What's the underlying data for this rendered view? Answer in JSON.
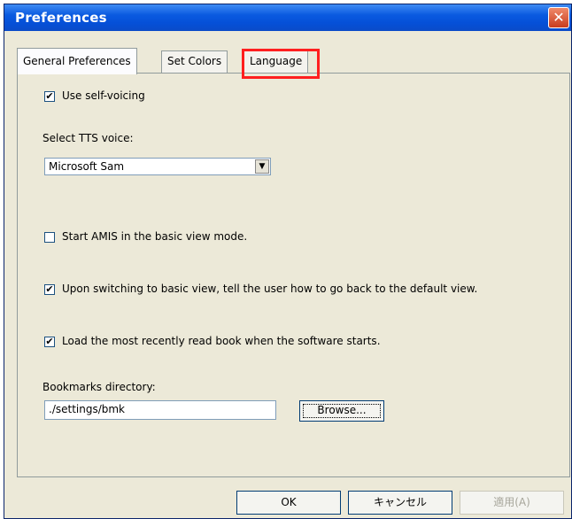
{
  "window": {
    "title": "Preferences",
    "close_glyph": "✕"
  },
  "tabs": [
    {
      "label": "General Preferences",
      "active": true
    },
    {
      "label": "Set Colors",
      "active": false
    },
    {
      "label": "Language",
      "active": false,
      "highlighted": true
    }
  ],
  "general": {
    "self_voicing": {
      "label": "Use self-voicing",
      "checked": true
    },
    "tts": {
      "label": "Select TTS voice:",
      "selected": "Microsoft Sam"
    },
    "basic_view": {
      "label": "Start AMIS in the basic view mode.",
      "checked": false
    },
    "tell_user": {
      "label": "Upon switching to basic view, tell the user how to go back to the default view.",
      "checked": true
    },
    "load_recent": {
      "label": "Load the most recently read book when the software starts.",
      "checked": true
    },
    "bookmarks": {
      "label": "Bookmarks directory:",
      "value": "./settings/bmk",
      "browse_label": "Browse..."
    }
  },
  "footer": {
    "ok_label": "OK",
    "cancel_label": "キャンセル",
    "apply_label": "適用(A)"
  },
  "colors": {
    "highlight": "#ff1f1f",
    "titlebar": "#0a5ae0"
  },
  "check_glyph": "✔"
}
